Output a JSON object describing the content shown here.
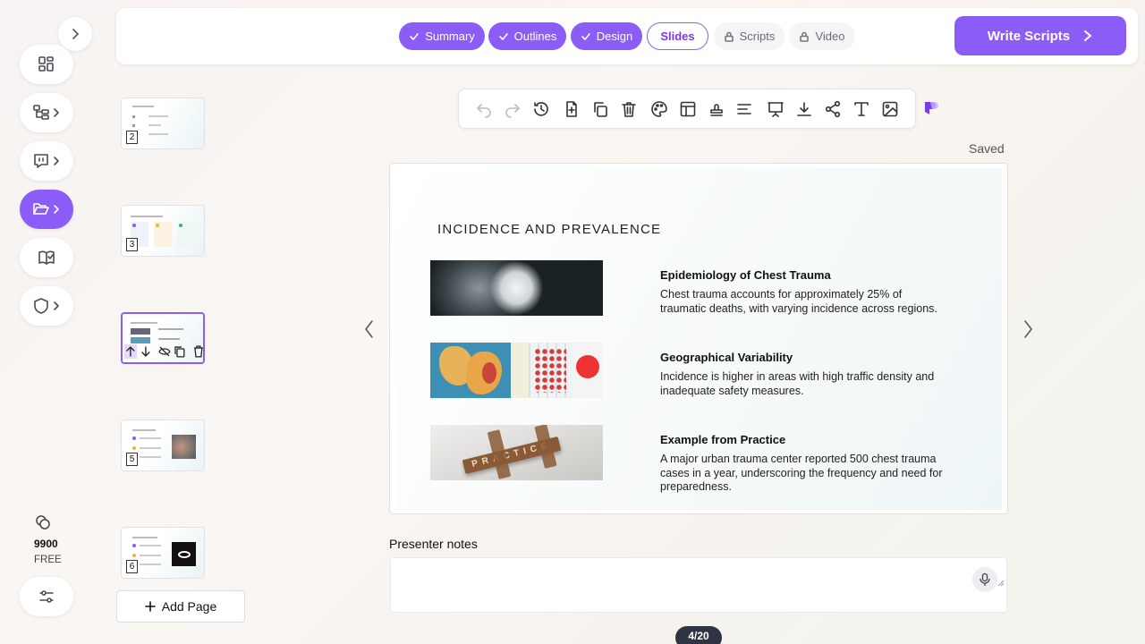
{
  "rail": {
    "credits_value": "9900",
    "plan": "FREE"
  },
  "steps": [
    {
      "label": "Summary",
      "state": "done"
    },
    {
      "label": "Outlines",
      "state": "done"
    },
    {
      "label": "Design",
      "state": "done"
    },
    {
      "label": "Slides",
      "state": "current"
    },
    {
      "label": "Scripts",
      "state": "locked"
    },
    {
      "label": "Video",
      "state": "locked"
    }
  ],
  "write_button": "Write Scripts",
  "status": "Saved",
  "thumbnails": [
    {
      "number": "2"
    },
    {
      "number": "3"
    },
    {
      "number": "4",
      "selected": true
    },
    {
      "number": "5"
    },
    {
      "number": "6"
    }
  ],
  "add_page": "Add Page",
  "slide": {
    "title": "INCIDENCE AND PREVALENCE",
    "items": [
      {
        "heading": "Epidemiology of Chest Trauma",
        "body": "Chest trauma accounts for approximately 25% of traumatic deaths, with varying incidence across regions.",
        "image": "chest-xray-image"
      },
      {
        "heading": "Geographical Variability",
        "body": "Incidence is higher in areas with high traffic density and inadequate safety measures.",
        "image": "world-map-image"
      },
      {
        "heading": "Example from Practice",
        "body": "A major urban trauma center reported 500 chest trauma cases in a year, underscoring the frequency and need for preparedness.",
        "image": "practice-tiles-image"
      }
    ]
  },
  "notes_label": "Presenter notes",
  "page_indicator": "4/20",
  "colors": {
    "accent": "#8b5cf6"
  }
}
